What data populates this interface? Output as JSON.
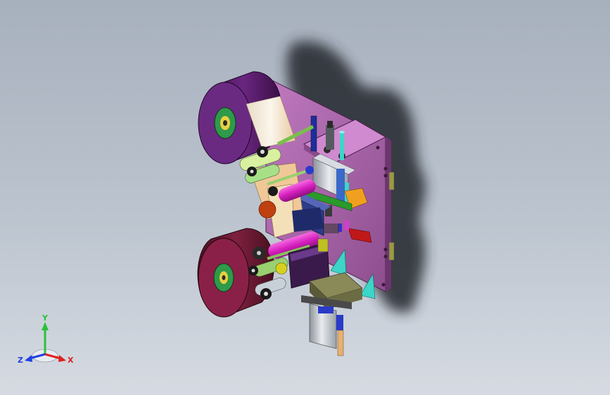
{
  "viewport": {
    "background_top": "#a7b0bd",
    "background_bottom": "#d6dbe2"
  },
  "assembly": {
    "icon": "label-applicator-3d-model",
    "colors": {
      "plate": "#b46ab3",
      "reel": "#5a1e6a",
      "reel_lower": "#6b1a3a",
      "hub": "#3aa05a",
      "label_web": "#f1e8d6",
      "magenta_roller": "#e026c9",
      "blue_block": "#2d3c8a",
      "cylinder": "#c4c8ce",
      "cyan_bracket": "#3bd6c8",
      "olive_pad": "#7b7a4a",
      "orange_plate": "#f0a020",
      "red_part": "#c01818",
      "shadow": "#2a2e35"
    }
  },
  "triad": {
    "y_label": "Y",
    "x_label": "X",
    "z_label": "Z",
    "y_color": "#2ac23a",
    "x_color": "#e02020",
    "z_color": "#2040e0"
  }
}
